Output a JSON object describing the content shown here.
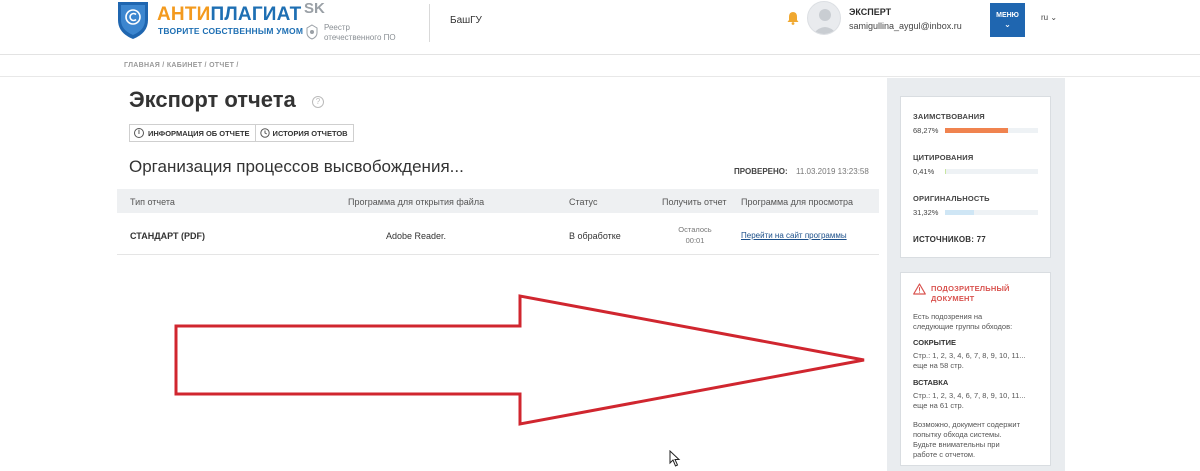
{
  "header": {
    "logo_part1": "АНТИ",
    "logo_part2": "ПЛАГИАТ",
    "logo_tagline": "ТВОРИТЕ СОБСТВЕННЫМ УМОМ",
    "sk_logo": "SK",
    "registry_line1": "Реестр",
    "registry_line2": "отечественного ПО",
    "org_name": "БашГУ",
    "user_role": "ЭКСПЕРТ",
    "user_email": "samigullina_aygul@inbox.ru",
    "menu_label": "МЕНЮ",
    "language": "ru"
  },
  "breadcrumb": [
    "ГЛАВНАЯ",
    "КАБИНЕТ",
    "ОТЧЕТ"
  ],
  "page": {
    "title": "Экспорт отчета",
    "tabs": [
      "ИНФОРМАЦИЯ ОБ ОТЧЕТЕ",
      "ИСТОРИЯ ОТЧЕТОВ"
    ],
    "document_title": "Организация процессов высвобождения...",
    "checked_label": "ПРОВЕРЕНО:",
    "checked_date": "11.03.2019 13:23:58"
  },
  "table": {
    "headers": [
      "Тип отчета",
      "Программа для открытия файла",
      "Статус",
      "Получить отчет",
      "Программа для просмотра"
    ],
    "rows": [
      {
        "type": "СТАНДАРТ (PDF)",
        "program": "Adobe Reader.",
        "status": "В обработке",
        "remaining_label": "Осталось",
        "remaining_time": "00:01",
        "viewer_link": "Перейти на сайт программы"
      }
    ]
  },
  "stats": {
    "borrowing_label": "ЗАИМСТВОВАНИЯ",
    "borrowing_value": "68,27%",
    "borrowing_fraction": 0.6827,
    "citation_label": "ЦИТИРОВАНИЯ",
    "citation_value": "0,41%",
    "citation_fraction": 0.0041,
    "originality_label": "ОРИГИНАЛЬНОСТЬ",
    "originality_value": "31,32%",
    "originality_fraction": 0.3132,
    "sources_label": "ИСТОЧНИКОВ:",
    "sources_count": "77",
    "colors": {
      "borrowing": "#f0834f",
      "citation": "#c8e6a0",
      "originality": "#cfe6f5"
    }
  },
  "warning": {
    "title": "ПОДОЗРИТЕЛЬНЫЙ ДОКУМЕНТ",
    "intro_line1": "Есть подозрения на",
    "intro_line2": "следующие группы обходов:",
    "group1_title": "СОКРЫТИЕ",
    "group1_pages": "Стр.: 1, 2, 3, 4, 6, 7, 8, 9, 10, 11...",
    "group1_more": "еще на 58 стр.",
    "group2_title": "ВСТАВКА",
    "group2_pages": "Стр.: 1, 2, 3, 4, 6, 7, 8, 9, 10, 11...",
    "group2_more": "еще на 61 стр.",
    "note_line1": "Возможно, документ содержит",
    "note_line2": "попытку обхода системы.",
    "note_line3": "Будьте внимательны при",
    "note_line4": "работе с отчетом."
  },
  "colors": {
    "brand_blue": "#1f66b0",
    "brand_orange": "#f39a1e",
    "warning_red": "#d9534f",
    "annotation_arrow": "#d0262f"
  },
  "icons": [
    "shield-logo-icon",
    "sk-logo-icon",
    "registry-emblem-icon",
    "bell-icon",
    "avatar-icon",
    "chevron-down-icon",
    "help-icon",
    "info-icon",
    "clock-icon",
    "warning-triangle-icon",
    "cursor-icon",
    "arrow-annotation"
  ]
}
